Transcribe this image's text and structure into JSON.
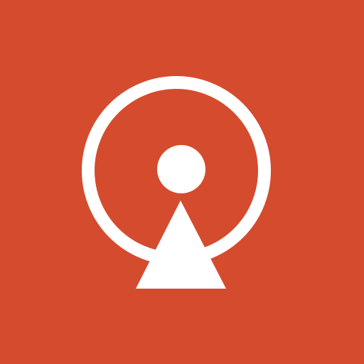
{
  "app_icon": {
    "name": "location-pin-icon",
    "background_color": "#d54b2e",
    "foreground_color": "#ffffff"
  }
}
